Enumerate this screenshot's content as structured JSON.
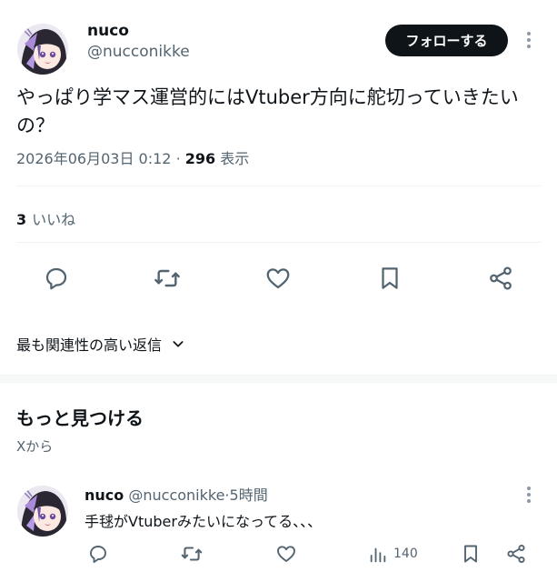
{
  "tweet": {
    "author_name": "nuco",
    "author_handle": "@nucconikke",
    "follow_label": "フォローする",
    "text": "やっぱり学マス運営的にはVtuber方向に舵切っていきたいの？",
    "timestamp": "2026年06月03日 0:12",
    "separator": "·",
    "views_count": "296",
    "views_label": "表示",
    "likes_count": "3",
    "likes_label": "いいね"
  },
  "actions": [
    "reply-icon",
    "retweet-icon",
    "like-icon",
    "bookmark-icon",
    "share-icon"
  ],
  "replies_sort": {
    "label": "最も関連性の高い返信"
  },
  "discover": {
    "title": "もっと見つける",
    "subtitle": "Xから"
  },
  "recommended": {
    "author_name": "nuco",
    "author_handle": "@nucconikke",
    "separator": "·",
    "time": "5時間",
    "text": "手毬がVtuberみたいになってる、、、",
    "views": "140"
  },
  "colors": {
    "text_primary": "#0f1419",
    "text_secondary": "#536471",
    "divider": "#eff3f4",
    "follow_bg": "#0f1419"
  }
}
